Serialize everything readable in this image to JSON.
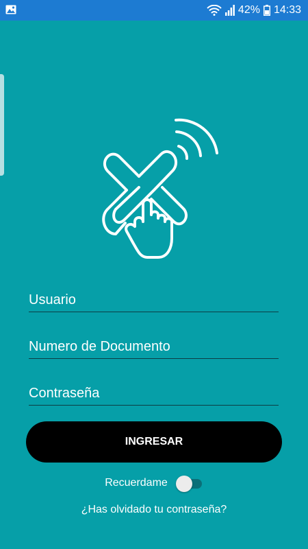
{
  "status_bar": {
    "battery": "42%",
    "time": "14:33",
    "icons": [
      "gallery-icon",
      "wifi-icon",
      "signal-icon",
      "battery-icon"
    ]
  },
  "logo": {
    "icon": "tap-wireless-logo-icon"
  },
  "form": {
    "username_label": "Usuario",
    "document_label": "Numero de Documento",
    "password_label": "Contraseña"
  },
  "login_button": {
    "label": "INGRESAR"
  },
  "remember": {
    "label": "Recuerdame",
    "enabled": false
  },
  "forgot_password": {
    "label": "¿Has olvidado tu contraseña?"
  },
  "colors": {
    "background": "#069fa8",
    "status_bar": "#1d7bd2",
    "button": "#000000",
    "field_line": "#0c3d44"
  }
}
